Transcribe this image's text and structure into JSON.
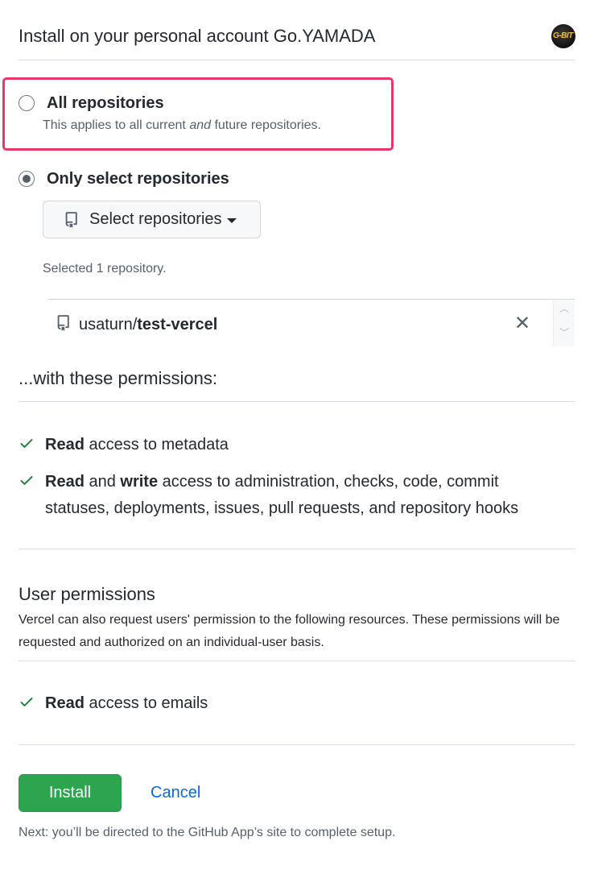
{
  "header": {
    "title": "Install on your personal account Go.YAMADA",
    "avatar_text": "G-BIT"
  },
  "repo_access": {
    "all": {
      "label": "All repositories",
      "desc_prefix": "This applies to all current ",
      "desc_emphasis": "and",
      "desc_suffix": " future repositories.",
      "selected": false
    },
    "only_select": {
      "label": "Only select repositories",
      "selected": true
    },
    "select_button_label": "Select repositories",
    "selected_count_text": "Selected 1 repository.",
    "selected_repos": [
      {
        "owner": "usaturn/",
        "name": "test-vercel"
      }
    ],
    "remove_glyph": "✕"
  },
  "permissions": {
    "heading": "...with these permissions:",
    "items": [
      {
        "bold1": "Read",
        "rest": " access to metadata"
      },
      {
        "bold1": "Read",
        "mid": " and ",
        "bold2": "write",
        "rest": " access to administration, checks, code, commit statuses, deployments, issues, pull requests, and repository hooks"
      }
    ]
  },
  "user_permissions": {
    "heading": "User permissions",
    "description": "Vercel can also request users' permission to the following resources. These permissions will be requested and authorized on an individual-user basis.",
    "items": [
      {
        "bold1": "Read",
        "rest": " access to emails"
      }
    ]
  },
  "actions": {
    "install_label": "Install",
    "cancel_label": "Cancel",
    "next_note": "Next: you’ll be directed to the GitHub App’s site to complete setup."
  },
  "colors": {
    "accent_green": "#2da44e",
    "link_blue": "#0969da",
    "highlight_pink": "#e8386a",
    "check_green": "#1a7f37"
  }
}
